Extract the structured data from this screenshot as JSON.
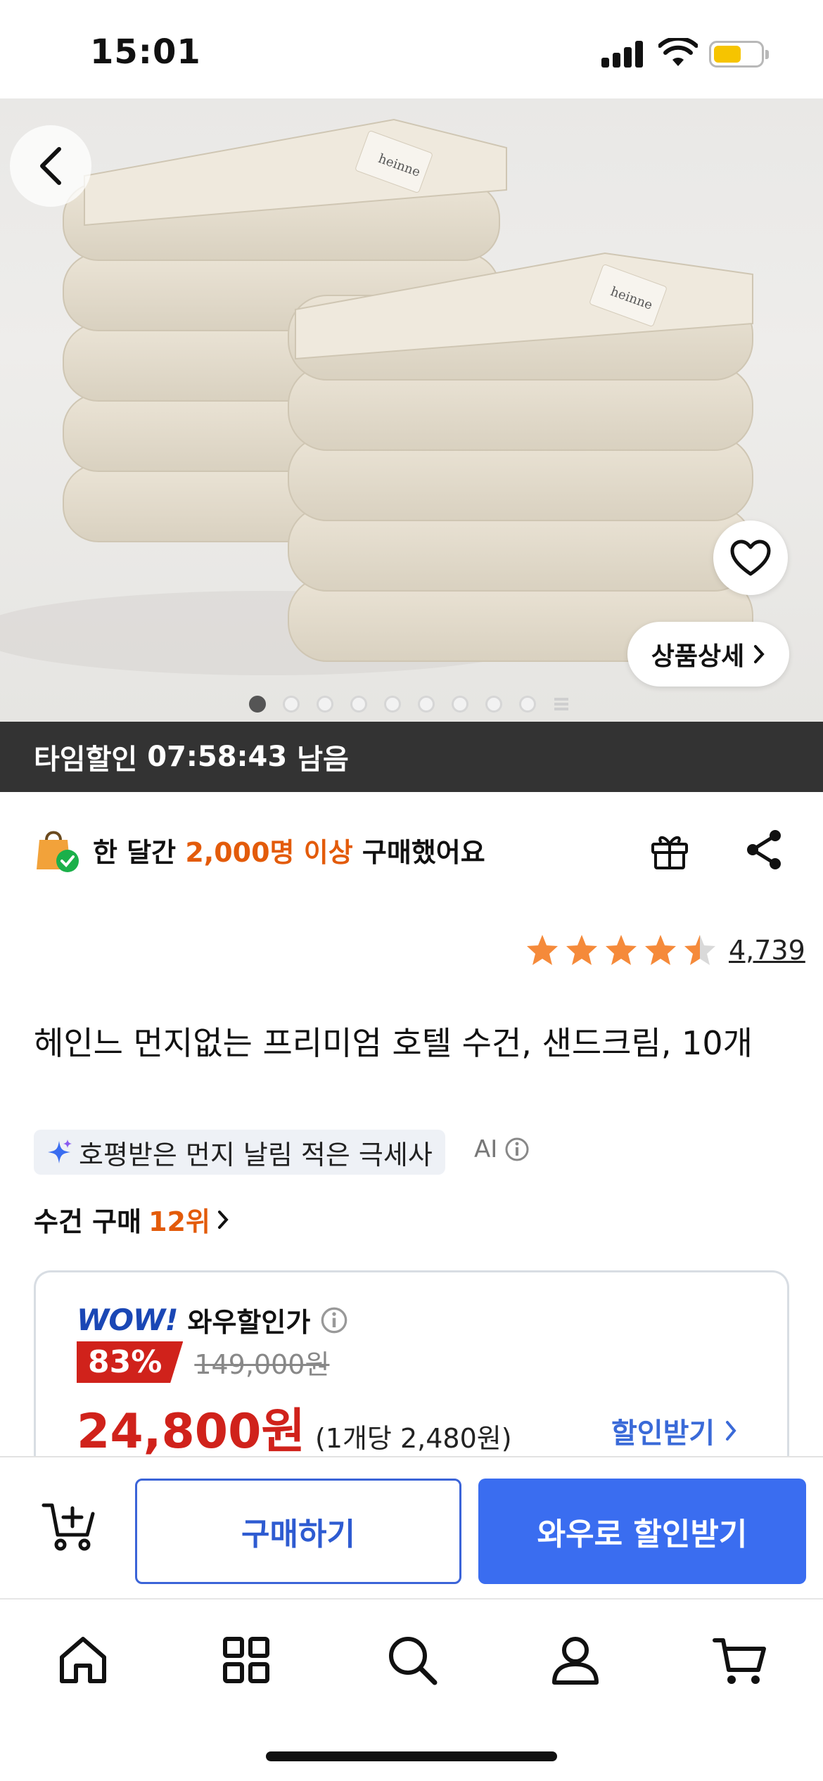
{
  "status_bar": {
    "time": "15:01"
  },
  "product_image": {
    "label_text": "heinne",
    "detail_button": "상품상세",
    "image_count": 10,
    "current_image": 1
  },
  "timer": {
    "label": "타임할인",
    "time": "07:58:43",
    "suffix": "남음"
  },
  "buyers": {
    "prefix": "한 달간",
    "highlight": "2,000명 이상",
    "suffix": "구매했어요"
  },
  "rating": {
    "stars": 4.5,
    "count": "4,739"
  },
  "product": {
    "title": "헤인느 먼지없는 프리미엄 호텔 수건, 샌드크림, 10개",
    "ai_summary": "호평받은 먼지 날림 적은 극세사",
    "ai_label": "AI",
    "rank_prefix": "수건 구매",
    "rank_value": "12위"
  },
  "price": {
    "wow_logo": "WOW!",
    "wow_label": "와우할인가",
    "discount": "83%",
    "original": "149,000원",
    "sale": "24,800원",
    "unit": "(1개당 2,480원)",
    "get_discount": "할인받기"
  },
  "actions": {
    "buy": "구매하기",
    "wow_discount": "와우로 할인받기"
  },
  "colors": {
    "accent_blue": "#3a6df0",
    "sale_red": "#d0221b",
    "highlight_orange": "#e35b0a",
    "star": "#f58a3a"
  }
}
